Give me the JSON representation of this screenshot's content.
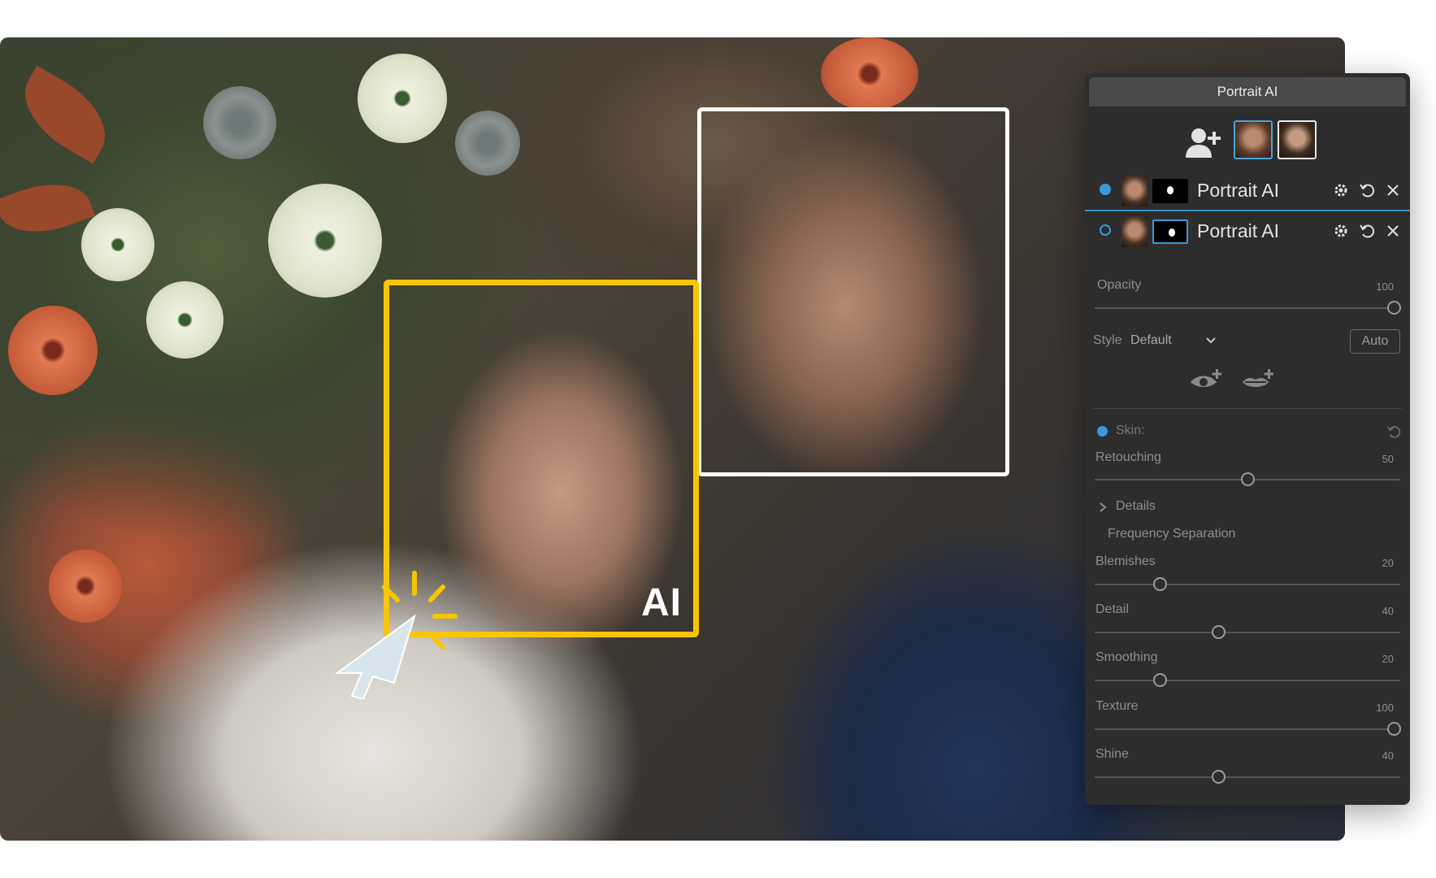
{
  "panel": {
    "title": "Portrait AI",
    "layers": [
      {
        "name": "Portrait AI",
        "active": true
      },
      {
        "name": "Portrait AI",
        "active": false
      }
    ],
    "opacity": {
      "label": "Opacity",
      "value": "100"
    },
    "style": {
      "label": "Style",
      "value": "Default",
      "auto_label": "Auto"
    },
    "skin": {
      "label": "Skin:"
    },
    "retouching": {
      "label": "Retouching",
      "value": "50"
    },
    "details_label": "Details",
    "frequency_label": "Frequency Separation",
    "sliders": [
      {
        "label": "Blemishes",
        "value": "20"
      },
      {
        "label": "Detail",
        "value": "40"
      },
      {
        "label": "Smoothing",
        "value": "20"
      },
      {
        "label": "Texture",
        "value": "100"
      },
      {
        "label": "Shine",
        "value": "40"
      }
    ]
  },
  "photo": {
    "badge": "AI"
  },
  "colors": {
    "accent": "#3a9ad9",
    "selection_frame": "#f7c600",
    "panel_bg": "#2d2d2d"
  },
  "icons": [
    "add-face-icon",
    "gear-icon",
    "reset-icon",
    "close-icon",
    "chevron-down-icon",
    "add-eye-icon",
    "add-lips-icon",
    "chevron-right-icon",
    "cursor-arrow-icon"
  ]
}
